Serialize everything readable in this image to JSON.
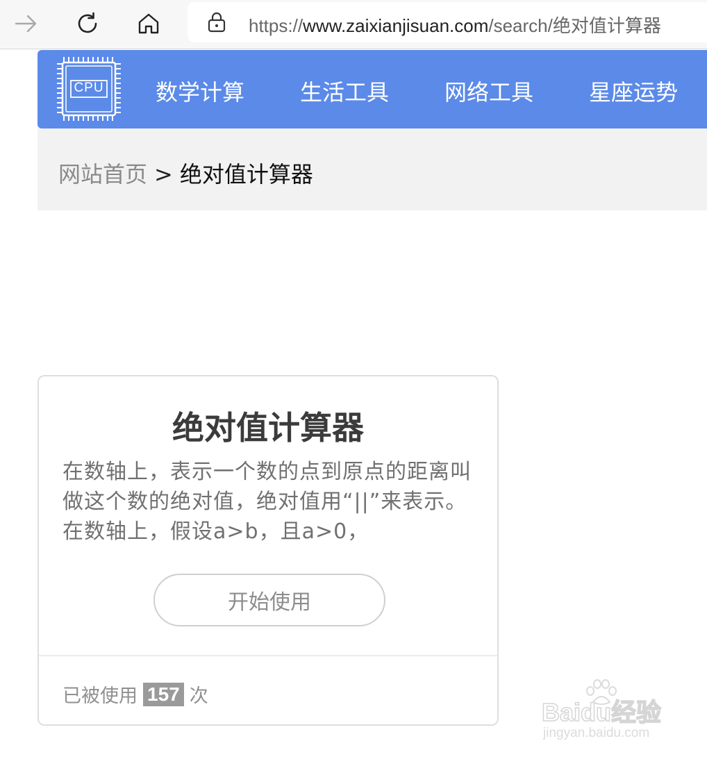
{
  "browser": {
    "url_prefix": "https://",
    "url_host": "www.zaixianjisuan.com",
    "url_path": "/search/",
    "url_query": "绝对值计算器"
  },
  "site": {
    "logo_text": "CPU",
    "nav": [
      "数学计算",
      "生活工具",
      "网络工具",
      "星座运势"
    ],
    "brand_color": "#5b8ae8"
  },
  "breadcrumb": {
    "home": "网站首页",
    "separator": ">",
    "current": "绝对值计算器"
  },
  "card": {
    "title": "绝对值计算器",
    "description": "在数轴上，表示一个数的点到原点的距离叫做这个数的绝对值，绝对值用“||”来表示。在数轴上，假设a>b，且a>0，",
    "start_button": "开始使用",
    "usage_prefix": "已被使用",
    "usage_count": "157",
    "usage_suffix": "次"
  },
  "watermark": {
    "main": "Baidu经验",
    "sub": "jingyan.baidu.com"
  }
}
